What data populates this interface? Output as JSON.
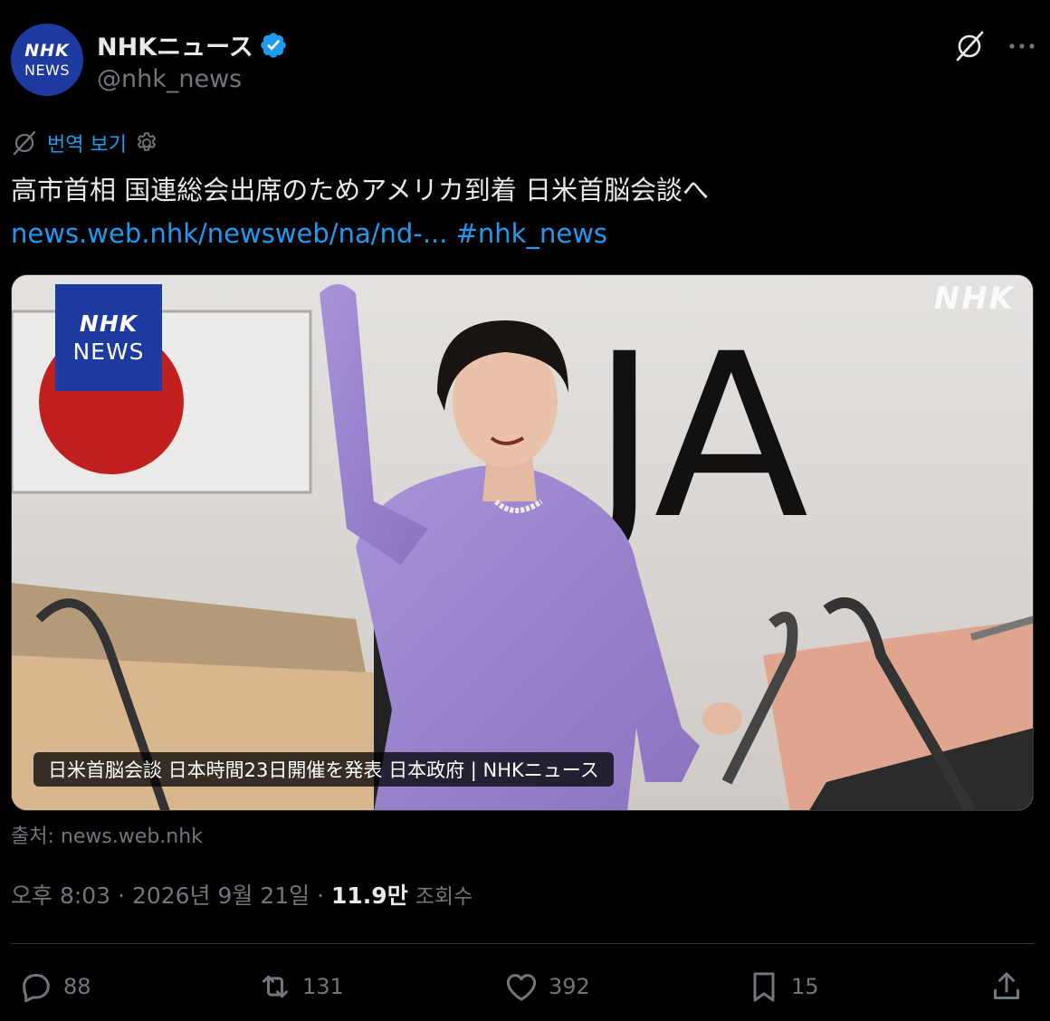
{
  "author": {
    "avatar_line1": "NHK",
    "avatar_line2": "NEWS",
    "name": "NHKニュース",
    "handle": "@nhk_news",
    "verified": true
  },
  "translate": {
    "label": "번역 보기"
  },
  "tweet": {
    "text": "高市首相 国連総会出席のためアメリカ到着 日米首脳会談へ",
    "link": "news.web.nhk/newsweb/na/nd-...",
    "hashtag": "#nhk_news"
  },
  "media": {
    "logo_line1": "NHK",
    "logo_line2": "NEWS",
    "watermark": "NHK",
    "plane_lettering": "JA",
    "caption": "日米首脳会談 日本時間23日開催を発表 日本政府 | NHKニュース"
  },
  "source": "출처: news.web.nhk",
  "meta": {
    "time": "오후 8:03",
    "sep": " · ",
    "date": "2026년 9월 21일",
    "views_num": "11.9만",
    "views_label": "조회수"
  },
  "actions": {
    "replies": "88",
    "reposts": "131",
    "likes": "392",
    "bookmarks": "15"
  },
  "colors": {
    "background": "#000000",
    "link": "#1d9bf0",
    "muted": "#71767b",
    "text": "#e7e9ea",
    "nhk_blue": "#1d3aa0"
  }
}
